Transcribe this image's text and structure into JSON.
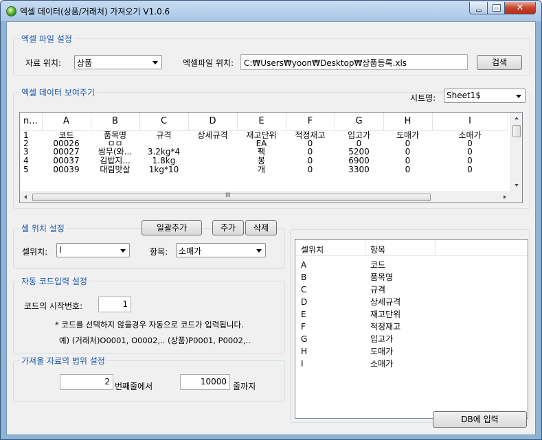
{
  "window": {
    "title": "엑셀 데이터(상품/거래처) 가져오기  V1.0.6"
  },
  "excel_settings": {
    "group_title": "엑셀 파일 설정",
    "data_location_label": "자료 위치:",
    "data_location_value": "상품",
    "file_path_label": "엑셀파일 위치:",
    "file_path_value": "C:₩Users₩yoon₩Desktop₩상품등록.xls",
    "search_button": "검색"
  },
  "data_view": {
    "group_title": "엑셀 데이터 보여주기",
    "sheet_label": "시트명:",
    "sheet_value": "Sheet1$",
    "columns": [
      "n...",
      "A",
      "B",
      "C",
      "D",
      "E",
      "F",
      "G",
      "H",
      "I"
    ],
    "rows": [
      [
        "1",
        "코드",
        "품목명",
        "규격",
        "상세규격",
        "재고단위",
        "적정재고",
        "입고가",
        "도매가",
        "소매가"
      ],
      [
        "2",
        "00026",
        "ㅁㅁ",
        "",
        "",
        "EA",
        "0",
        "0",
        "0",
        "0"
      ],
      [
        "3",
        "00027",
        "쌈무(와...",
        "3.2kg*4",
        "",
        "팩",
        "0",
        "5200",
        "0",
        "0"
      ],
      [
        "4",
        "00037",
        "김밥지...",
        "1.8kg",
        "",
        "봉",
        "0",
        "6900",
        "0",
        "0"
      ],
      [
        "5",
        "00039",
        "대림맛살",
        "1kg*10",
        "",
        "개",
        "0",
        "3300",
        "0",
        "0"
      ]
    ],
    "hscroll_grip": "III"
  },
  "cell_position": {
    "group_title": "셀 위치 설정",
    "bulk_add_button": "일괄추가",
    "add_button": "추가",
    "delete_button": "삭제",
    "cell_label": "셀위치:",
    "cell_value": "I",
    "item_label": "항목:",
    "item_value": "소매가"
  },
  "auto_code": {
    "group_title": "자동 코드입력 설정",
    "start_label": "코드의 시작번호:",
    "start_value": "1",
    "note_line1": "* 코드를 선택하지 않을경우 자동으로 코드가 입력됩니다.",
    "note_line2": "예) (거래처)O0001, O0002,..  (상품)P0001, P0002,.."
  },
  "range": {
    "group_title": "가져올 자료의 범위 설정",
    "from_value": "2",
    "from_label": "번째줄에서",
    "to_value": "10000",
    "to_label": "줄까지"
  },
  "mapping": {
    "headers": [
      "셀위치",
      "항목"
    ],
    "rows": [
      [
        "A",
        "코드"
      ],
      [
        "B",
        "품목명"
      ],
      [
        "C",
        "규격"
      ],
      [
        "D",
        "상세규격"
      ],
      [
        "E",
        "재고단위"
      ],
      [
        "F",
        "적정재고"
      ],
      [
        "G",
        "입고가"
      ],
      [
        "H",
        "도매가"
      ],
      [
        "I",
        "소매가"
      ]
    ]
  },
  "db_button": "DB에 입력"
}
